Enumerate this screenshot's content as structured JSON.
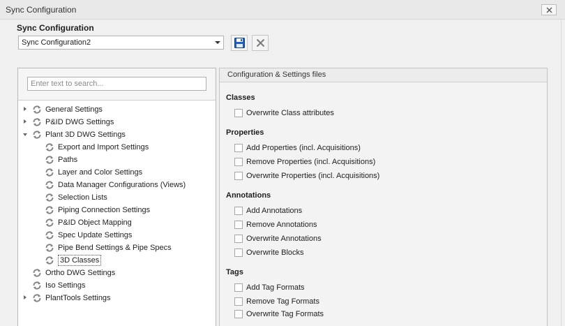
{
  "window": {
    "title": "Sync Configuration"
  },
  "config": {
    "label": "Sync Configuration",
    "selected": "Sync Configuration2"
  },
  "search": {
    "placeholder": "Enter text to search..."
  },
  "tree": [
    {
      "label": "General Settings",
      "level": 0,
      "state": "collapsed"
    },
    {
      "label": "P&ID DWG Settings",
      "level": 0,
      "state": "collapsed"
    },
    {
      "label": "Plant 3D DWG Settings",
      "level": 0,
      "state": "expanded"
    },
    {
      "label": "Export and Import Settings",
      "level": 1
    },
    {
      "label": "Paths",
      "level": 1
    },
    {
      "label": "Layer and Color Settings",
      "level": 1
    },
    {
      "label": "Data Manager Configurations (Views)",
      "level": 1
    },
    {
      "label": "Selection Lists",
      "level": 1
    },
    {
      "label": "Piping Connection Settings",
      "level": 1
    },
    {
      "label": "P&ID Object Mapping",
      "level": 1
    },
    {
      "label": "Spec Update Settings",
      "level": 1
    },
    {
      "label": "Pipe Bend Settings & Pipe Specs",
      "level": 1
    },
    {
      "label": "3D Classes",
      "level": 1,
      "selected": true
    },
    {
      "label": "Ortho DWG Settings",
      "level": 0,
      "state": "none"
    },
    {
      "label": "Iso Settings",
      "level": 0,
      "state": "none"
    },
    {
      "label": "PlantTools Settings",
      "level": 0,
      "state": "collapsed"
    }
  ],
  "right": {
    "header": "Configuration & Settings files",
    "sections": [
      {
        "title": "Classes",
        "options": [
          {
            "label": "Overwrite Class attributes",
            "checked": false
          }
        ]
      },
      {
        "title": "Properties",
        "options": [
          {
            "label": "Add Properties (incl. Acquisitions)",
            "checked": false
          },
          {
            "label": "Remove Properties (incl. Acquisitions)",
            "checked": false
          },
          {
            "label": "Overwrite Properties (incl. Acquisitions)",
            "checked": false
          }
        ]
      },
      {
        "title": "Annotations",
        "options": [
          {
            "label": "Add Annotations",
            "checked": false
          },
          {
            "label": "Remove Annotations",
            "checked": false
          },
          {
            "label": "Overwrite Annotations",
            "checked": false
          },
          {
            "label": "Overwrite Blocks",
            "checked": false
          }
        ]
      },
      {
        "title": "Tags",
        "options": [
          {
            "label": "Add Tag Formats",
            "checked": false
          },
          {
            "label": "Remove Tag Formats",
            "checked": false
          },
          {
            "label": "Overwrite Tag Formats",
            "checked": false
          }
        ]
      }
    ]
  },
  "icons": {
    "close": "close-icon",
    "save": "floppy-disk-icon",
    "delete": "delete-x-icon",
    "tree_item": "sync-arrows-icon",
    "dropdown": "chevron-down-icon"
  },
  "colors": {
    "save_blue": "#1f5fb8",
    "icon_gray": "#7a7a7a",
    "panel_bg": "#f3f3f3",
    "window_bg": "#f0f0f0"
  }
}
